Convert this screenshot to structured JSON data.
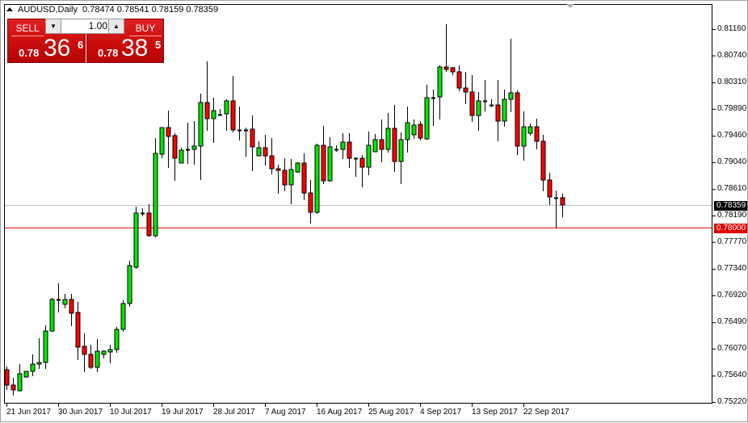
{
  "header": {
    "symbol_timeframe": "AUDUSD,Daily",
    "open": "0.78474",
    "high": "0.78541",
    "low": "0.78159",
    "close": "0.78359"
  },
  "trade_panel": {
    "sell_label": "SELL",
    "buy_label": "BUY",
    "lot_value": "1.00",
    "sell_price": {
      "prefix": "0.78",
      "big": "36",
      "sup": "6"
    },
    "buy_price": {
      "prefix": "0.78",
      "big": "38",
      "sup": "5"
    }
  },
  "colors": {
    "bull": "#00e600",
    "bear": "#ff0000",
    "bid_line": "#c0c0c0",
    "level_line": "#e00000"
  },
  "chart_data": {
    "type": "candlestick",
    "title": "AUDUSD,Daily",
    "ylim": [
      0.7522,
      0.8116
    ],
    "yticks": [
      "0.81160",
      "0.80740",
      "0.80310",
      "0.79890",
      "0.79460",
      "0.79040",
      "0.78610",
      "0.78190",
      "0.77770",
      "0.77340",
      "0.76920",
      "0.76490",
      "0.76070",
      "0.75640",
      "0.75220"
    ],
    "bid": {
      "value": 0.78359,
      "label": "0.78359"
    },
    "level": {
      "value": 0.78,
      "label": "0.78000"
    },
    "xticks": [
      {
        "bar": 0,
        "label": "21 Jun 2017"
      },
      {
        "bar": 8,
        "label": "30 Jun 2017"
      },
      {
        "bar": 16,
        "label": "10 Jul 2017"
      },
      {
        "bar": 24,
        "label": "19 Jul 2017"
      },
      {
        "bar": 32,
        "label": "28 Jul 2017"
      },
      {
        "bar": 40,
        "label": "7 Aug 2017"
      },
      {
        "bar": 48,
        "label": "16 Aug 2017"
      },
      {
        "bar": 56,
        "label": "25 Aug 2017"
      },
      {
        "bar": 64,
        "label": "4 Sep 2017"
      },
      {
        "bar": 72,
        "label": "13 Sep 2017"
      },
      {
        "bar": 80,
        "label": "22 Sep 2017"
      }
    ],
    "ohlc": [
      [
        0.75734,
        0.75786,
        0.75413,
        0.7549
      ],
      [
        0.7549,
        0.75606,
        0.75323,
        0.75413
      ],
      [
        0.754,
        0.75824,
        0.75387,
        0.7567
      ],
      [
        0.75619,
        0.75709,
        0.75606,
        0.75709
      ],
      [
        0.75709,
        0.75979,
        0.75631,
        0.75824
      ],
      [
        0.75824,
        0.76236,
        0.75747,
        0.7585
      ],
      [
        0.7585,
        0.76441,
        0.75747,
        0.76351
      ],
      [
        0.76351,
        0.76879,
        0.76339,
        0.76853
      ],
      [
        0.76853,
        0.7711,
        0.76647,
        0.76855
      ],
      [
        0.76776,
        0.76943,
        0.76711,
        0.76853
      ],
      [
        0.76853,
        0.76943,
        0.76429,
        0.76634
      ],
      [
        0.76647,
        0.76814,
        0.75889,
        0.76094
      ],
      [
        0.76107,
        0.76313,
        0.75696,
        0.75979
      ],
      [
        0.75979,
        0.76133,
        0.75747,
        0.75773
      ],
      [
        0.75773,
        0.76223,
        0.75696,
        0.7603
      ],
      [
        0.75979,
        0.76043,
        0.75914,
        0.7603
      ],
      [
        0.76017,
        0.76133,
        0.75837,
        0.76056
      ],
      [
        0.76056,
        0.76416,
        0.76004,
        0.76377
      ],
      [
        0.76377,
        0.7684,
        0.76339,
        0.76789
      ],
      [
        0.76789,
        0.7747,
        0.76737,
        0.77393
      ],
      [
        0.77367,
        0.78331,
        0.77341,
        0.78229
      ],
      [
        0.78229,
        0.78306,
        0.78177,
        0.78232
      ],
      [
        0.78229,
        0.7837,
        0.77856,
        0.77869
      ],
      [
        0.77869,
        0.79424,
        0.77843,
        0.7918
      ],
      [
        0.79167,
        0.79591,
        0.79103,
        0.79591
      ],
      [
        0.79591,
        0.79861,
        0.78949,
        0.7945
      ],
      [
        0.79463,
        0.79501,
        0.78743,
        0.79103
      ],
      [
        0.79026,
        0.7927,
        0.79026,
        0.79231
      ],
      [
        0.79244,
        0.79669,
        0.79013,
        0.79246
      ],
      [
        0.79244,
        0.79694,
        0.79,
        0.79296
      ],
      [
        0.79296,
        0.80131,
        0.78756,
        0.7999
      ],
      [
        0.7999,
        0.80646,
        0.7954,
        0.79733
      ],
      [
        0.79733,
        0.80067,
        0.79347,
        0.79861
      ],
      [
        0.79797,
        0.79887,
        0.79784,
        0.79799
      ],
      [
        0.7981,
        0.80041,
        0.7954,
        0.80016
      ],
      [
        0.80016,
        0.80414,
        0.79514,
        0.79553
      ],
      [
        0.79553,
        0.79926,
        0.79386,
        0.79551
      ],
      [
        0.79553,
        0.79591,
        0.79129,
        0.79551
      ],
      [
        0.79566,
        0.79784,
        0.78897,
        0.79283
      ],
      [
        0.79141,
        0.79373,
        0.79141,
        0.7927
      ],
      [
        0.7927,
        0.79476,
        0.78987,
        0.79141
      ],
      [
        0.79141,
        0.79424,
        0.78846,
        0.78936
      ],
      [
        0.78936,
        0.79,
        0.78537,
        0.7891
      ],
      [
        0.7891,
        0.79103,
        0.78576,
        0.78679
      ],
      [
        0.78679,
        0.7909,
        0.7837,
        0.78923
      ],
      [
        0.78884,
        0.79039,
        0.78871,
        0.79026
      ],
      [
        0.79026,
        0.7918,
        0.78434,
        0.7855
      ],
      [
        0.7855,
        0.78756,
        0.78061,
        0.78241
      ],
      [
        0.78241,
        0.79334,
        0.78216,
        0.79309
      ],
      [
        0.79309,
        0.79617,
        0.78691,
        0.78743
      ],
      [
        0.78743,
        0.79437,
        0.7873,
        0.79283
      ],
      [
        0.79244,
        0.79309,
        0.79206,
        0.79246
      ],
      [
        0.79244,
        0.79501,
        0.7909,
        0.7936
      ],
      [
        0.7936,
        0.79501,
        0.78949,
        0.79103
      ],
      [
        0.79103,
        0.79116,
        0.78807,
        0.79101
      ],
      [
        0.79103,
        0.79154,
        0.78639,
        0.78961
      ],
      [
        0.78961,
        0.79527,
        0.78833,
        0.79309
      ],
      [
        0.79206,
        0.79489,
        0.79206,
        0.79399
      ],
      [
        0.79399,
        0.7972,
        0.79039,
        0.79244
      ],
      [
        0.79244,
        0.79823,
        0.79193,
        0.79579
      ],
      [
        0.79579,
        0.79951,
        0.78884,
        0.79051
      ],
      [
        0.79051,
        0.79514,
        0.78691,
        0.79399
      ],
      [
        0.79399,
        0.79926,
        0.79193,
        0.79669
      ],
      [
        0.79476,
        0.7972,
        0.79411,
        0.7963
      ],
      [
        0.79643,
        0.79694,
        0.79386,
        0.79424
      ],
      [
        0.79411,
        0.80273,
        0.79399,
        0.80067
      ],
      [
        0.80067,
        0.80196,
        0.79617,
        0.80069
      ],
      [
        0.8008,
        0.80581,
        0.7972,
        0.80556
      ],
      [
        0.80556,
        0.81237,
        0.80479,
        0.80517
      ],
      [
        0.80543,
        0.80556,
        0.80427,
        0.80479
      ],
      [
        0.80479,
        0.80581,
        0.8017,
        0.80221
      ],
      [
        0.80221,
        0.80479,
        0.79964,
        0.80157
      ],
      [
        0.80157,
        0.80427,
        0.79681,
        0.79784
      ],
      [
        0.79784,
        0.80157,
        0.7954,
        0.80016
      ],
      [
        0.80016,
        0.8035,
        0.79849,
        0.80018
      ],
      [
        0.79951,
        0.80041,
        0.79913,
        0.79953
      ],
      [
        0.79951,
        0.8035,
        0.79373,
        0.79694
      ],
      [
        0.79694,
        0.80196,
        0.79604,
        0.80041
      ],
      [
        0.80041,
        0.81006,
        0.79836,
        0.80144
      ],
      [
        0.80144,
        0.80183,
        0.79154,
        0.79296
      ],
      [
        0.79296,
        0.79849,
        0.79064,
        0.79604
      ],
      [
        0.79501,
        0.79656,
        0.79463,
        0.79604
      ],
      [
        0.79604,
        0.79733,
        0.79244,
        0.79373
      ],
      [
        0.79373,
        0.79476,
        0.78576,
        0.78756
      ],
      [
        0.78756,
        0.78871,
        0.78359,
        0.78486
      ],
      [
        0.78473,
        0.78589,
        0.77984,
        0.78474
      ],
      [
        0.78474,
        0.78541,
        0.78159,
        0.78359
      ]
    ]
  }
}
